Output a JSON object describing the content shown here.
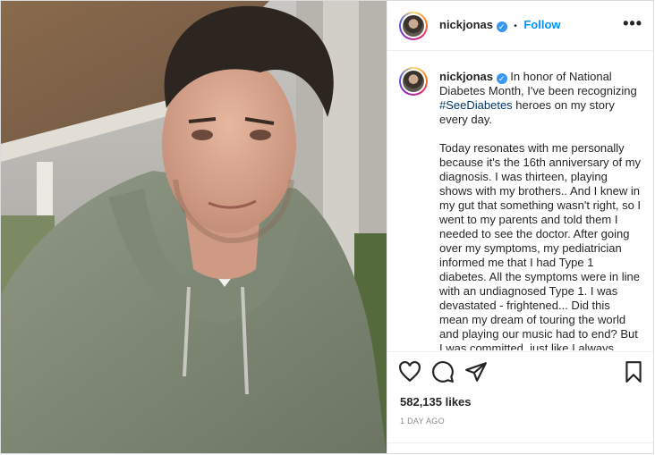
{
  "post": {
    "username": "nickjonas",
    "verified_mark": "✓",
    "follow_label": "Follow",
    "more_label": "•••",
    "caption": {
      "intro": "In honor of National Diabetes Month, I've been recognizing",
      "hashtag": "#SeeDiabetes",
      "intro_end": "heroes on my story every day.",
      "body": "Today resonates with me personally because it's the 16th anniversary of my diagnosis. I was thirteen, playing shows with my brothers.. And I knew in my gut that something wasn't right, so I went to my parents and told them I needed to see the doctor.  After going over my symptoms, my pediatrician informed me that I had Type 1 diabetes. All the symptoms were in line with an undiagnosed Type 1. I was devastated - frightened... Did this mean my dream of touring the world and playing our music had to end? But I was committed, just like I always have been, to not letting it"
    },
    "likes": "582,135 likes",
    "timestamp": "1 DAY AGO",
    "icons": [
      "heart-icon",
      "comment-icon",
      "share-icon",
      "bookmark-icon",
      "more-icon",
      "verified-icon"
    ]
  }
}
